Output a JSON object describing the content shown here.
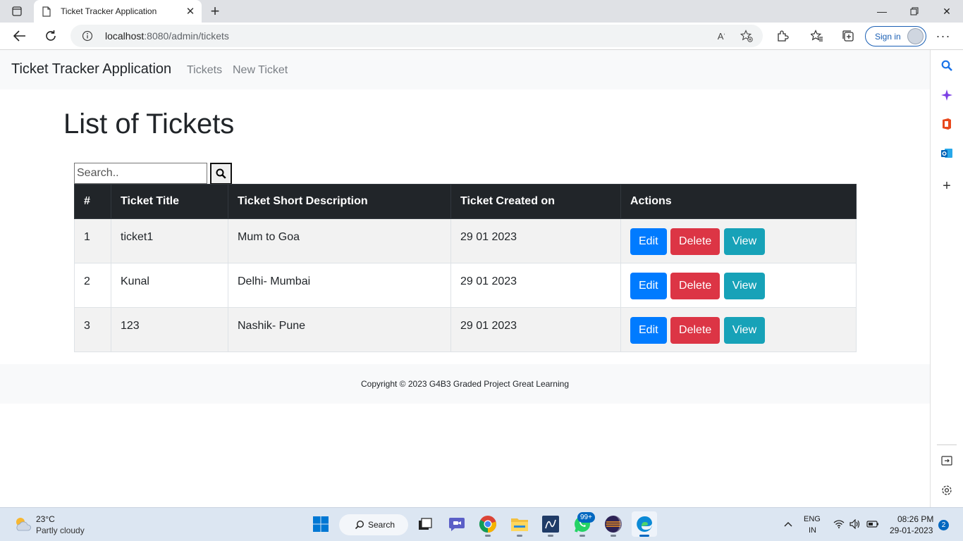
{
  "browser": {
    "tab_title": "Ticket Tracker Application",
    "url_host": "localhost",
    "url_path": ":8080/admin/tickets",
    "signin_label": "Sign in"
  },
  "app": {
    "brand": "Ticket Tracker Application",
    "nav": {
      "tickets": "Tickets",
      "new_ticket": "New Ticket"
    },
    "heading": "List of Tickets",
    "search_placeholder": "Search..",
    "table": {
      "columns": [
        "#",
        "Ticket Title",
        "Ticket Short Description",
        "Ticket Created on",
        "Actions"
      ],
      "rows": [
        {
          "id": "1",
          "title": "ticket1",
          "description": "Mum to Goa",
          "created_on": "29 01 2023"
        },
        {
          "id": "2",
          "title": "Kunal",
          "description": "Delhi- Mumbai",
          "created_on": "29 01 2023"
        },
        {
          "id": "3",
          "title": "123",
          "description": "Nashik- Pune",
          "created_on": "29 01 2023"
        }
      ],
      "actions": {
        "edit": "Edit",
        "delete": "Delete",
        "view": "View"
      }
    },
    "footer": "Copyright © 2023 G4B3 Graded Project Great Learning"
  },
  "taskbar": {
    "weather_temp": "23°C",
    "weather_desc": "Partly cloudy",
    "search_label": "Search",
    "whatsapp_badge": "99+",
    "lang_line1": "ENG",
    "lang_line2": "IN",
    "time": "08:26 PM",
    "date": "29-01-2023",
    "notification_count": "2"
  },
  "colors": {
    "btn_edit": "#007bff",
    "btn_delete": "#dc3545",
    "btn_view": "#17a2b8",
    "table_header": "#212529"
  }
}
